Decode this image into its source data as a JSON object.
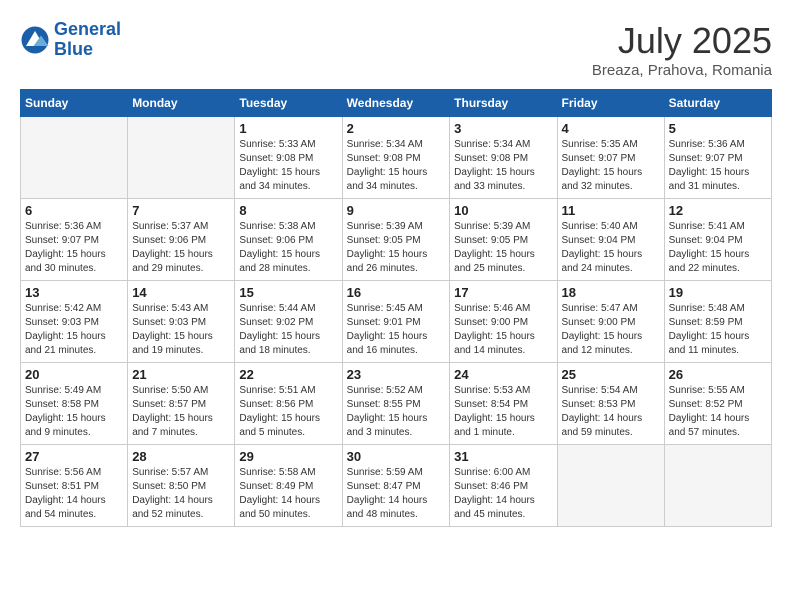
{
  "header": {
    "logo_line1": "General",
    "logo_line2": "Blue",
    "month": "July 2025",
    "location": "Breaza, Prahova, Romania"
  },
  "weekdays": [
    "Sunday",
    "Monday",
    "Tuesday",
    "Wednesday",
    "Thursday",
    "Friday",
    "Saturday"
  ],
  "weeks": [
    [
      {
        "num": "",
        "empty": true
      },
      {
        "num": "",
        "empty": true
      },
      {
        "num": "1",
        "sunrise": "Sunrise: 5:33 AM",
        "sunset": "Sunset: 9:08 PM",
        "daylight": "Daylight: 15 hours and 34 minutes."
      },
      {
        "num": "2",
        "sunrise": "Sunrise: 5:34 AM",
        "sunset": "Sunset: 9:08 PM",
        "daylight": "Daylight: 15 hours and 34 minutes."
      },
      {
        "num": "3",
        "sunrise": "Sunrise: 5:34 AM",
        "sunset": "Sunset: 9:08 PM",
        "daylight": "Daylight: 15 hours and 33 minutes."
      },
      {
        "num": "4",
        "sunrise": "Sunrise: 5:35 AM",
        "sunset": "Sunset: 9:07 PM",
        "daylight": "Daylight: 15 hours and 32 minutes."
      },
      {
        "num": "5",
        "sunrise": "Sunrise: 5:36 AM",
        "sunset": "Sunset: 9:07 PM",
        "daylight": "Daylight: 15 hours and 31 minutes."
      }
    ],
    [
      {
        "num": "6",
        "sunrise": "Sunrise: 5:36 AM",
        "sunset": "Sunset: 9:07 PM",
        "daylight": "Daylight: 15 hours and 30 minutes."
      },
      {
        "num": "7",
        "sunrise": "Sunrise: 5:37 AM",
        "sunset": "Sunset: 9:06 PM",
        "daylight": "Daylight: 15 hours and 29 minutes."
      },
      {
        "num": "8",
        "sunrise": "Sunrise: 5:38 AM",
        "sunset": "Sunset: 9:06 PM",
        "daylight": "Daylight: 15 hours and 28 minutes."
      },
      {
        "num": "9",
        "sunrise": "Sunrise: 5:39 AM",
        "sunset": "Sunset: 9:05 PM",
        "daylight": "Daylight: 15 hours and 26 minutes."
      },
      {
        "num": "10",
        "sunrise": "Sunrise: 5:39 AM",
        "sunset": "Sunset: 9:05 PM",
        "daylight": "Daylight: 15 hours and 25 minutes."
      },
      {
        "num": "11",
        "sunrise": "Sunrise: 5:40 AM",
        "sunset": "Sunset: 9:04 PM",
        "daylight": "Daylight: 15 hours and 24 minutes."
      },
      {
        "num": "12",
        "sunrise": "Sunrise: 5:41 AM",
        "sunset": "Sunset: 9:04 PM",
        "daylight": "Daylight: 15 hours and 22 minutes."
      }
    ],
    [
      {
        "num": "13",
        "sunrise": "Sunrise: 5:42 AM",
        "sunset": "Sunset: 9:03 PM",
        "daylight": "Daylight: 15 hours and 21 minutes."
      },
      {
        "num": "14",
        "sunrise": "Sunrise: 5:43 AM",
        "sunset": "Sunset: 9:03 PM",
        "daylight": "Daylight: 15 hours and 19 minutes."
      },
      {
        "num": "15",
        "sunrise": "Sunrise: 5:44 AM",
        "sunset": "Sunset: 9:02 PM",
        "daylight": "Daylight: 15 hours and 18 minutes."
      },
      {
        "num": "16",
        "sunrise": "Sunrise: 5:45 AM",
        "sunset": "Sunset: 9:01 PM",
        "daylight": "Daylight: 15 hours and 16 minutes."
      },
      {
        "num": "17",
        "sunrise": "Sunrise: 5:46 AM",
        "sunset": "Sunset: 9:00 PM",
        "daylight": "Daylight: 15 hours and 14 minutes."
      },
      {
        "num": "18",
        "sunrise": "Sunrise: 5:47 AM",
        "sunset": "Sunset: 9:00 PM",
        "daylight": "Daylight: 15 hours and 12 minutes."
      },
      {
        "num": "19",
        "sunrise": "Sunrise: 5:48 AM",
        "sunset": "Sunset: 8:59 PM",
        "daylight": "Daylight: 15 hours and 11 minutes."
      }
    ],
    [
      {
        "num": "20",
        "sunrise": "Sunrise: 5:49 AM",
        "sunset": "Sunset: 8:58 PM",
        "daylight": "Daylight: 15 hours and 9 minutes."
      },
      {
        "num": "21",
        "sunrise": "Sunrise: 5:50 AM",
        "sunset": "Sunset: 8:57 PM",
        "daylight": "Daylight: 15 hours and 7 minutes."
      },
      {
        "num": "22",
        "sunrise": "Sunrise: 5:51 AM",
        "sunset": "Sunset: 8:56 PM",
        "daylight": "Daylight: 15 hours and 5 minutes."
      },
      {
        "num": "23",
        "sunrise": "Sunrise: 5:52 AM",
        "sunset": "Sunset: 8:55 PM",
        "daylight": "Daylight: 15 hours and 3 minutes."
      },
      {
        "num": "24",
        "sunrise": "Sunrise: 5:53 AM",
        "sunset": "Sunset: 8:54 PM",
        "daylight": "Daylight: 15 hours and 1 minute."
      },
      {
        "num": "25",
        "sunrise": "Sunrise: 5:54 AM",
        "sunset": "Sunset: 8:53 PM",
        "daylight": "Daylight: 14 hours and 59 minutes."
      },
      {
        "num": "26",
        "sunrise": "Sunrise: 5:55 AM",
        "sunset": "Sunset: 8:52 PM",
        "daylight": "Daylight: 14 hours and 57 minutes."
      }
    ],
    [
      {
        "num": "27",
        "sunrise": "Sunrise: 5:56 AM",
        "sunset": "Sunset: 8:51 PM",
        "daylight": "Daylight: 14 hours and 54 minutes."
      },
      {
        "num": "28",
        "sunrise": "Sunrise: 5:57 AM",
        "sunset": "Sunset: 8:50 PM",
        "daylight": "Daylight: 14 hours and 52 minutes."
      },
      {
        "num": "29",
        "sunrise": "Sunrise: 5:58 AM",
        "sunset": "Sunset: 8:49 PM",
        "daylight": "Daylight: 14 hours and 50 minutes."
      },
      {
        "num": "30",
        "sunrise": "Sunrise: 5:59 AM",
        "sunset": "Sunset: 8:47 PM",
        "daylight": "Daylight: 14 hours and 48 minutes."
      },
      {
        "num": "31",
        "sunrise": "Sunrise: 6:00 AM",
        "sunset": "Sunset: 8:46 PM",
        "daylight": "Daylight: 14 hours and 45 minutes."
      },
      {
        "num": "",
        "empty": true
      },
      {
        "num": "",
        "empty": true
      }
    ]
  ]
}
